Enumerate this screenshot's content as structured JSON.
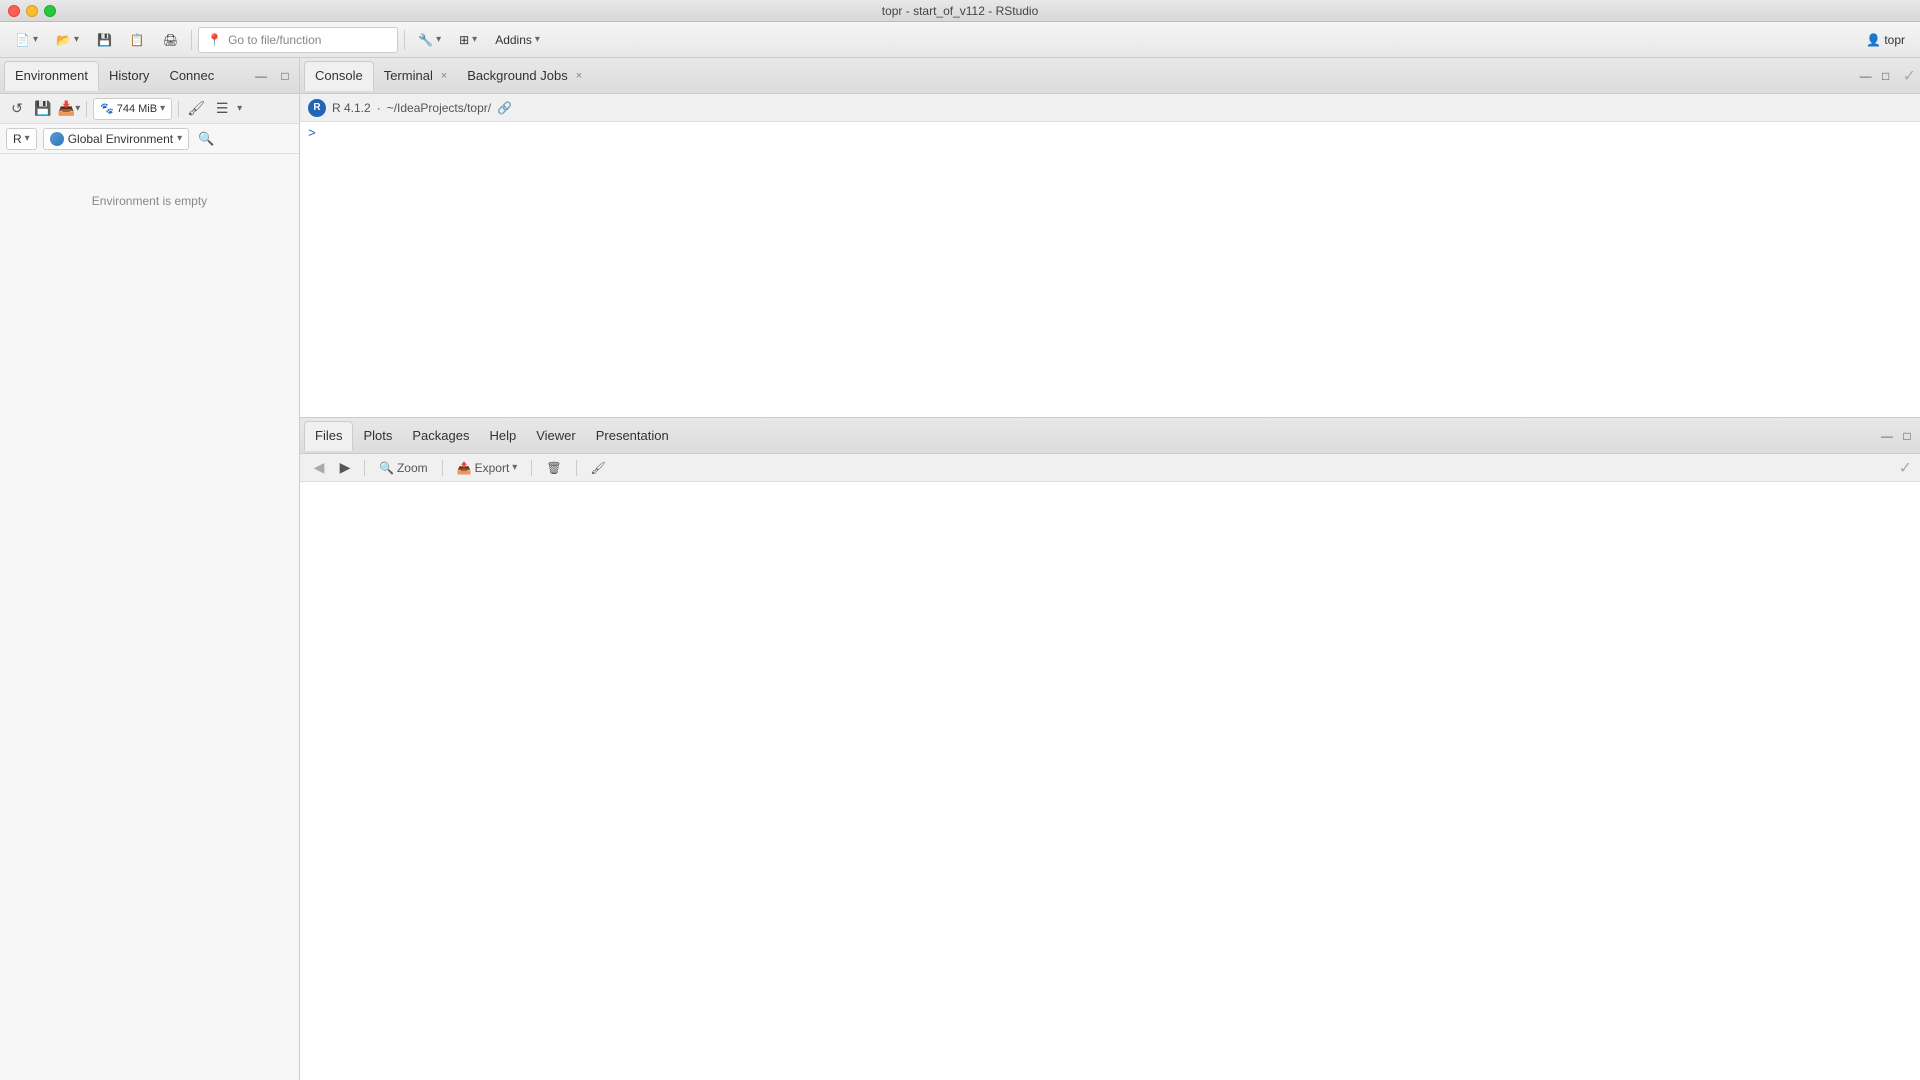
{
  "window": {
    "title": "topr - start_of_v112 - RStudio"
  },
  "toolbar": {
    "go_to_file_placeholder": "Go to file/function",
    "addins_label": "Addins",
    "user_label": "topr"
  },
  "left_panel": {
    "tabs": [
      {
        "id": "environment",
        "label": "Environment",
        "active": true
      },
      {
        "id": "history",
        "label": "History",
        "active": false
      },
      {
        "id": "connections",
        "label": "Connec",
        "active": false
      }
    ],
    "subtoolbar": {
      "memory_label": "744 MiB"
    },
    "r_version": "R",
    "environment": {
      "name": "Global Environment",
      "empty_message": "Environment is empty"
    }
  },
  "console_panel": {
    "tabs": [
      {
        "id": "console",
        "label": "Console",
        "closeable": false,
        "active": true
      },
      {
        "id": "terminal",
        "label": "Terminal",
        "closeable": true,
        "active": false
      },
      {
        "id": "background-jobs",
        "label": "Background Jobs",
        "closeable": true,
        "active": false
      }
    ],
    "r_version": "R 4.1.2",
    "path": "~/IdeaProjects/topr/",
    "prompt": ">"
  },
  "plots_panel": {
    "tabs": [
      {
        "id": "files",
        "label": "Files",
        "active": true
      },
      {
        "id": "plots",
        "label": "Plots",
        "active": false
      },
      {
        "id": "packages",
        "label": "Packages",
        "active": false
      },
      {
        "id": "help",
        "label": "Help",
        "active": false
      },
      {
        "id": "viewer",
        "label": "Viewer",
        "active": false
      },
      {
        "id": "presentation",
        "label": "Presentation",
        "active": false
      }
    ],
    "toolbar": {
      "zoom_label": "Zoom",
      "export_label": "Export"
    }
  },
  "icons": {
    "back": "◀",
    "forward": "▶",
    "close": "×",
    "dropdown": "▾",
    "search": "🔍",
    "minimize": "—",
    "maximize": "□",
    "refresh": "↺",
    "save": "💾",
    "new": "📄",
    "link": "🔗",
    "zoom": "🔍",
    "export": "📤",
    "clear": "🧹",
    "brush": "🖌",
    "checkmark": "✓"
  }
}
